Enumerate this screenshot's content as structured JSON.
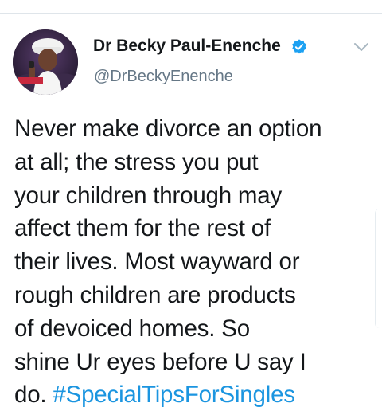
{
  "author": {
    "display_name": "Dr Becky Paul-Enenche",
    "handle": "@DrBeckyEnenche",
    "verified": true,
    "avatar_icon": "profile-photo"
  },
  "tweet": {
    "lines": [
      "Never make divorce an option",
      "at all; the stress you put",
      "your children through may",
      "affect them for the rest of",
      "their lives. Most wayward or",
      "rough children are products",
      "of devoiced homes. So",
      "shine Ur eyes before U say I"
    ],
    "last_line_text": "do.",
    "hashtag": "#SpecialTipsForSingles"
  },
  "colors": {
    "name": "#14171a",
    "handle": "#657786",
    "hashtag": "#1b95e0",
    "verified": "#1da1f2",
    "divider": "#dfe5ea"
  },
  "icons": {
    "verified": "verified-badge-icon",
    "menu": "chevron-down-icon"
  }
}
